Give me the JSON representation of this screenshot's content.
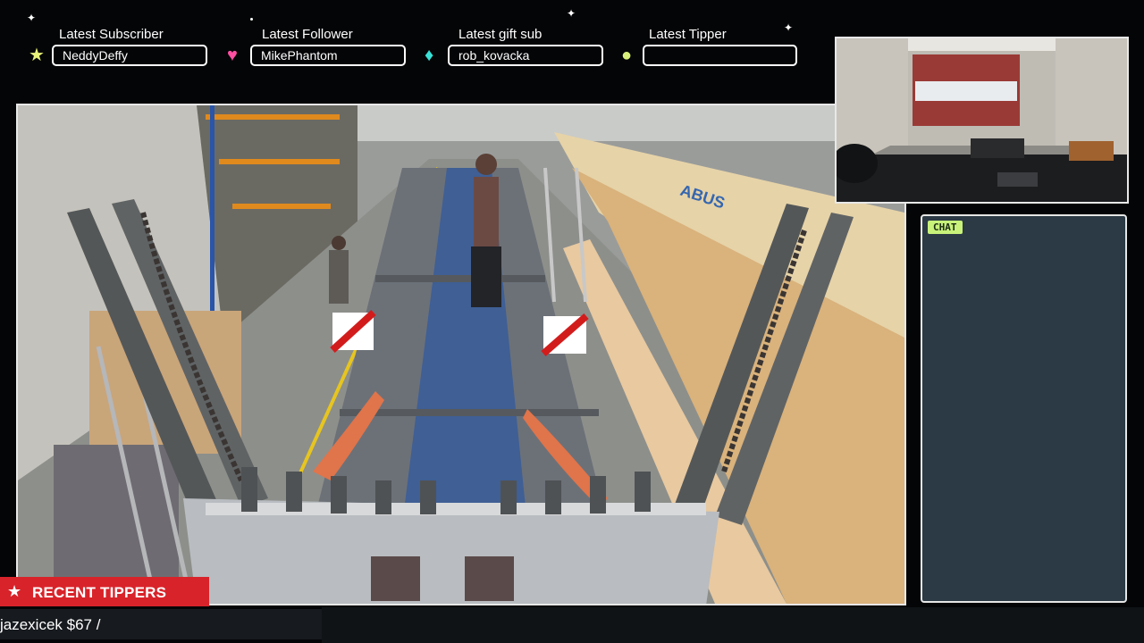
{
  "stats": [
    {
      "label": "Latest Subscriber",
      "value": "NeddyDeffy",
      "icon": "star-icon",
      "icon_color": "#e8f27a"
    },
    {
      "label": "Latest Follower",
      "value": "MikePhantom",
      "icon": "heart-icon",
      "icon_color": "#ff4fa3"
    },
    {
      "label": "Latest gift sub",
      "value": "rob_kovacka",
      "icon": "diamond-icon",
      "icon_color": "#39e0d6"
    },
    {
      "label": "Latest Tipper",
      "value": "",
      "icon": "coin-icon",
      "icon_color": "#d8f07a"
    }
  ],
  "chat": {
    "badge": "CHAT"
  },
  "tippers": {
    "header": "RECENT TIPPERS",
    "ticker": "jazexicek $67 /"
  },
  "colors": {
    "accent_red": "#d8232a",
    "chat_bg": "#2b3a45",
    "chat_badge": "#c8f27a"
  }
}
